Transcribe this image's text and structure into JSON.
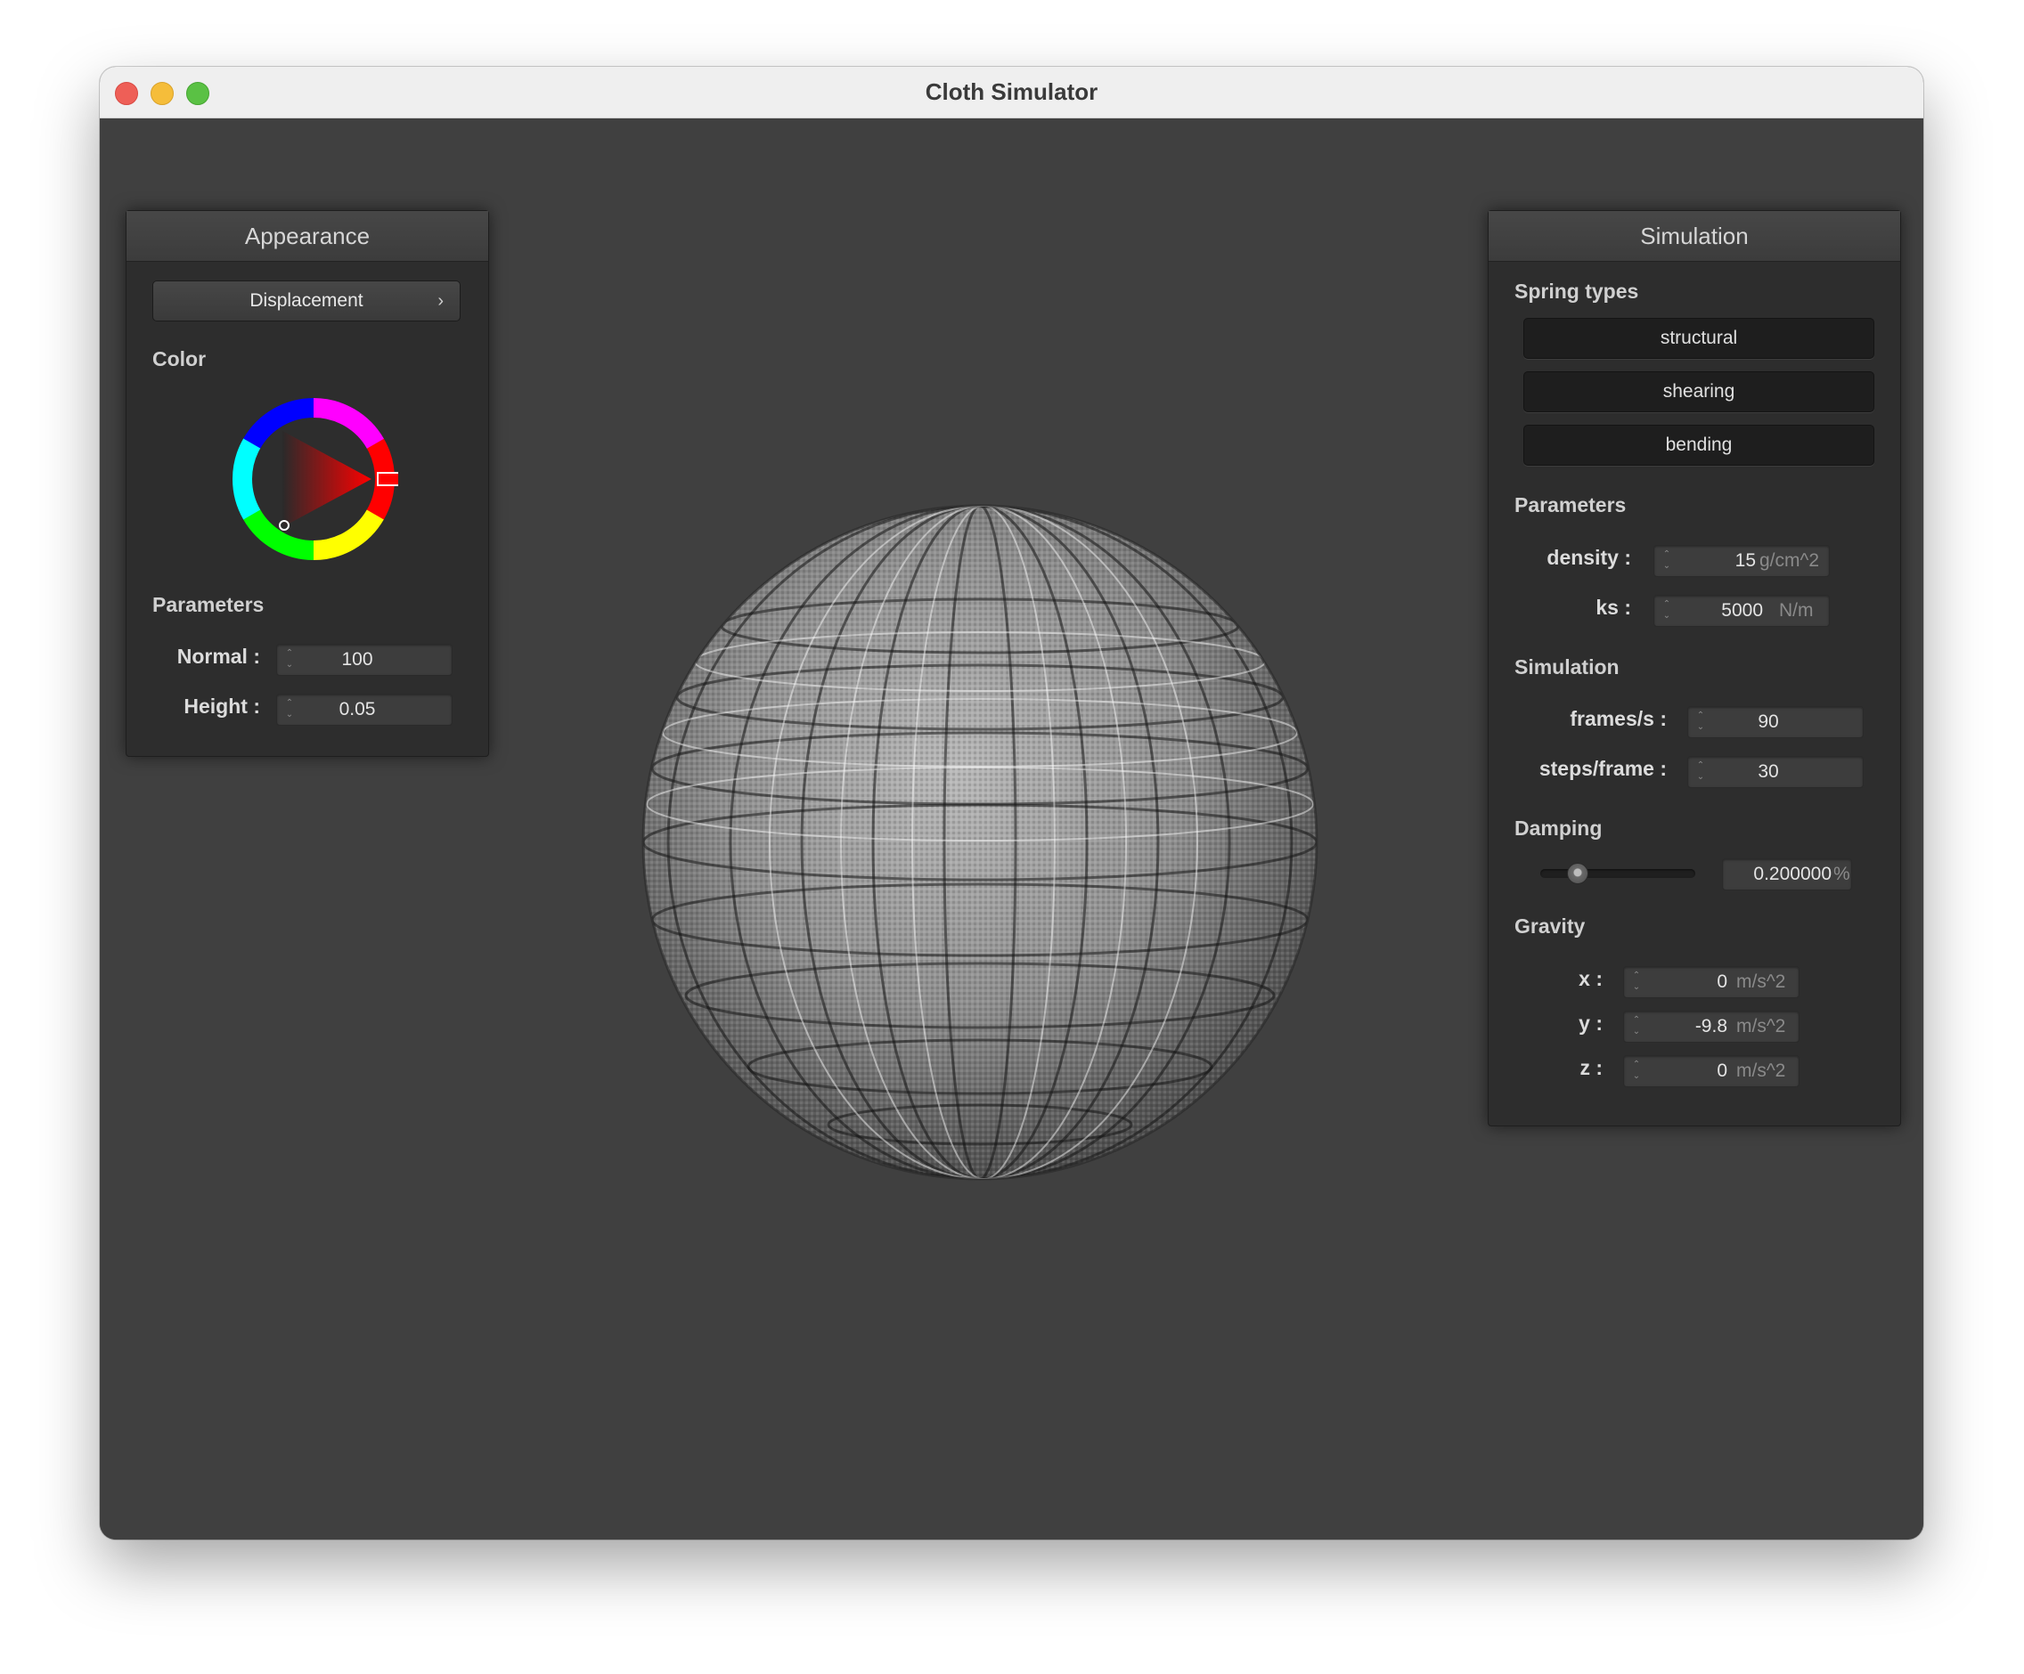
{
  "window": {
    "title": "Cloth Simulator"
  },
  "appearance": {
    "header": "Appearance",
    "shader_button": "Displacement",
    "color_label": "Color",
    "color_hue": "#ff0000",
    "parameters_label": "Parameters",
    "normal": {
      "label": "Normal :",
      "value": "100"
    },
    "height": {
      "label": "Height :",
      "value": "0.05"
    }
  },
  "simulation_panel": {
    "header": "Simulation",
    "spring_types_label": "Spring types",
    "spring_buttons": [
      "structural",
      "shearing",
      "bending"
    ],
    "parameters_label": "Parameters",
    "density": {
      "label": "density :",
      "value": "15",
      "unit": "g/cm^2"
    },
    "ks": {
      "label": "ks :",
      "value": "5000",
      "unit": "N/m"
    },
    "simulation_label": "Simulation",
    "fps": {
      "label": "frames/s :",
      "value": "90"
    },
    "steps": {
      "label": "steps/frame :",
      "value": "30"
    },
    "damping_label": "Damping",
    "damping": {
      "value": "0.200000",
      "unit": "%",
      "slider_fraction": 0.2
    },
    "gravity_label": "Gravity",
    "gravity": [
      {
        "label": "x :",
        "value": "0",
        "unit": "m/s^2"
      },
      {
        "label": "y :",
        "value": "-9.8",
        "unit": "m/s^2"
      },
      {
        "label": "z :",
        "value": "0",
        "unit": "m/s^2"
      }
    ]
  }
}
